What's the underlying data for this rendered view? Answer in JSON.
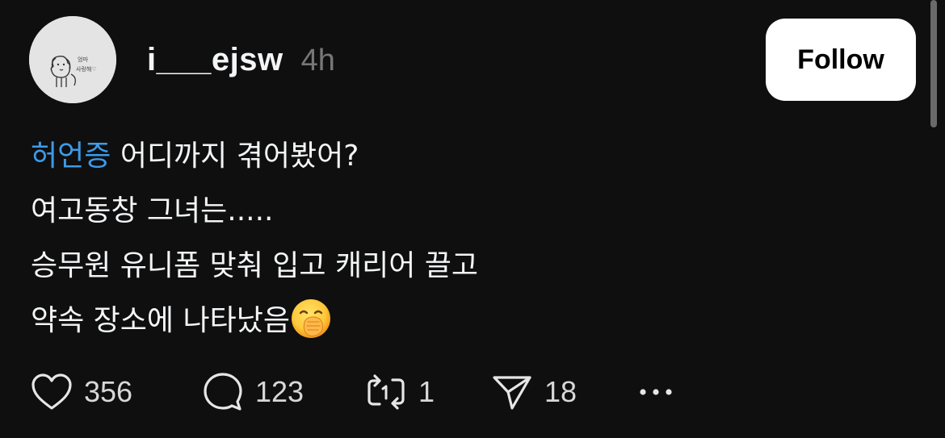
{
  "post": {
    "username": "i___ejsw",
    "timestamp": "4h",
    "follow_label": "Follow",
    "hashtag": "허언증",
    "lines": [
      " 어디까지 겪어봤어?",
      "여고동창 그녀는.....",
      "승무원 유니폼 맞춰 입고 캐리어 끌고",
      "약속 장소에 나타났음"
    ],
    "emoji": "face-with-hand-over-mouth",
    "avatar_text": [
      "엄마",
      "사랑해♡"
    ]
  },
  "actions": {
    "likes": "356",
    "replies": "123",
    "reposts": "1",
    "shares": "18",
    "more_icon": "ellipsis-icon"
  },
  "colors": {
    "background": "#0f0f0f",
    "hashtag": "#3d9be9",
    "text": "#f3f5f7",
    "muted": "#777777"
  }
}
